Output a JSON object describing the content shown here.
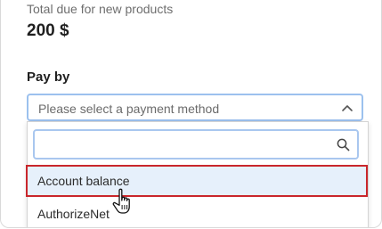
{
  "summary": {
    "total_label": "Total due for new products",
    "total_value": "200 $"
  },
  "payment": {
    "label": "Pay by",
    "select_placeholder": "Please select a payment method",
    "search_placeholder": "",
    "search_value": "",
    "options": [
      {
        "label": "Account balance",
        "state": "hovered"
      },
      {
        "label": "AuthorizeNet",
        "state": "normal"
      }
    ]
  },
  "colors": {
    "focus_border": "#9cc1ee",
    "hover_background": "#e6f0fb",
    "highlight_outline": "#c9262b"
  },
  "icons": {
    "chevron": "chevron-up-icon",
    "search": "search-icon",
    "cursor": "hand-pointer-icon"
  }
}
